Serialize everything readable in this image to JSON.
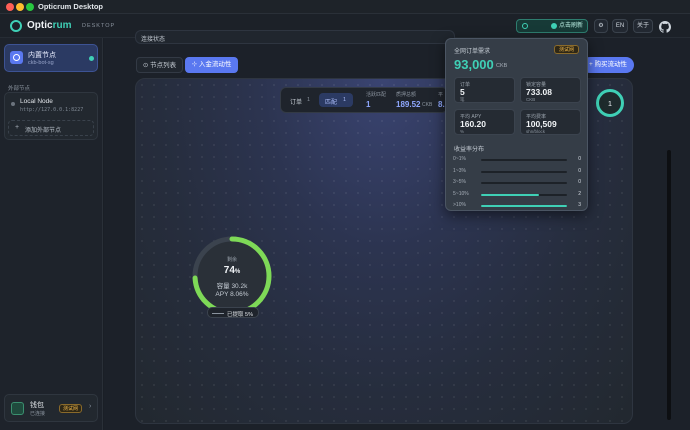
{
  "window": {
    "title": "Opticrum Desktop"
  },
  "app": {
    "brand_pre": "Optic",
    "brand_post": "rum",
    "brand_sub": "DESKTOP"
  },
  "header": {
    "connect_label": "点击刷新",
    "lang": "EN",
    "about": "关于"
  },
  "sidebar": {
    "builtin_title": "内置节点",
    "builtin_sub": "ckb-bot-sg",
    "external_heading": "外部节点",
    "local_name": "Local Node",
    "local_addr": "http://127.0.0.1:8227",
    "add_label": "添加外部节点",
    "wallet_title": "钱包",
    "wallet_sub": "已连接",
    "wallet_badge": "测试网"
  },
  "main": {
    "truncated_line": "连接状态",
    "tabs": [
      {
        "label": "节点列表"
      },
      {
        "label": "入金流动性"
      }
    ],
    "buy_label": "+ 购买流动性",
    "stats": {
      "order_label": "订单",
      "order_count": "1",
      "match_label": "匹配",
      "match_count": "1",
      "active_label": "活跃匹配",
      "active_val": "1",
      "amount_label": "质押总额",
      "amount_val": "189.52",
      "amount_unit": "CKB",
      "extra_label": "平",
      "extra_val": "8."
    },
    "ring_count": "1",
    "gauge": {
      "label": "剩余",
      "pct": 74,
      "pct_label": "74",
      "pct_sym": "%",
      "capacity": "容量 30.2k",
      "apy": "APY 8.06%",
      "withdraw": "已提取 5%"
    }
  },
  "popup": {
    "title": "全网订单需求",
    "badge": "测试网",
    "total": "93,000",
    "total_unit": "CKB",
    "cards": [
      {
        "label": "订单",
        "value": "5",
        "unit": "笔"
      },
      {
        "label": "锁定容量",
        "value": "733.08",
        "unit": "CKB"
      },
      {
        "label": "平均 APY",
        "value": "160.20",
        "unit": "%"
      },
      {
        "label": "平均费率",
        "value": "100,509",
        "unit": "shn/block"
      }
    ],
    "dist_title": "收益率分布",
    "dist": [
      {
        "label": "0~1%",
        "count": "0",
        "frac": 0
      },
      {
        "label": "1~3%",
        "count": "0",
        "frac": 0
      },
      {
        "label": "3~5%",
        "count": "0",
        "frac": 0
      },
      {
        "label": "5~10%",
        "count": "2",
        "frac": 0.67
      },
      {
        "label": ">10%",
        "count": "3",
        "frac": 1
      }
    ]
  },
  "colors": {
    "accent": "#3fd0b6",
    "primary": "#5a78f0",
    "gauge": "#7ed957",
    "badge": "#f2b94a"
  }
}
